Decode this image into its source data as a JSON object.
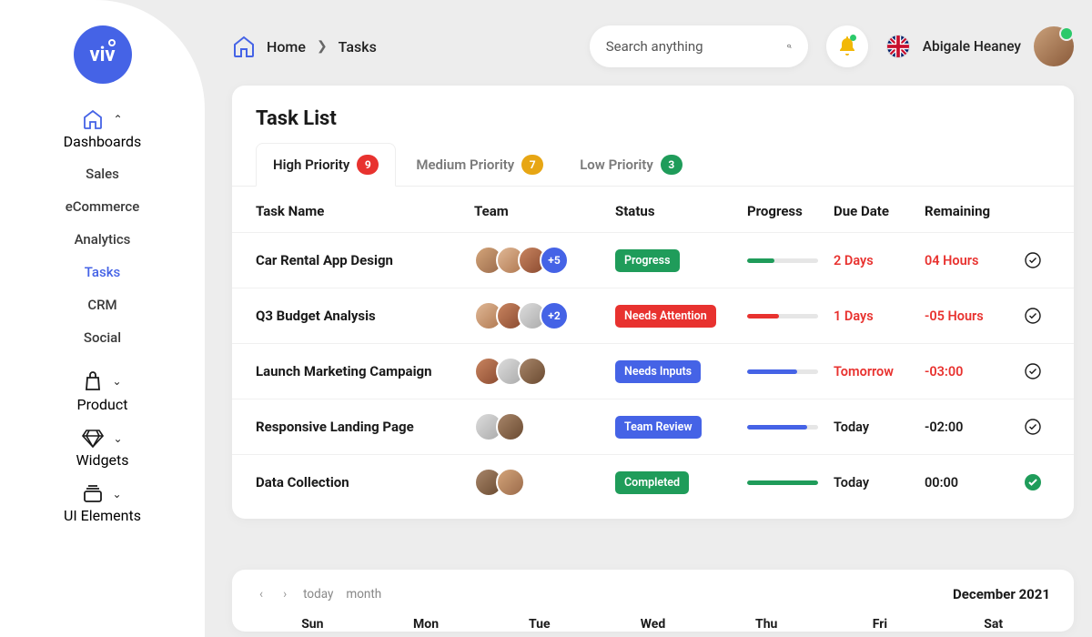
{
  "brand": "viv",
  "breadcrumb": {
    "home": "Home",
    "current": "Tasks"
  },
  "search": {
    "placeholder": "Search anything"
  },
  "user": {
    "name": "Abigale Heaney"
  },
  "sidebar": {
    "groups": [
      {
        "label": "Dashboards",
        "icon": "home",
        "expanded": true,
        "items": [
          "Sales",
          "eCommerce",
          "Analytics",
          "Tasks",
          "CRM",
          "Social"
        ],
        "activeIndex": 3
      },
      {
        "label": "Product",
        "icon": "bag",
        "expanded": false
      },
      {
        "label": "Widgets",
        "icon": "diamond",
        "expanded": false
      },
      {
        "label": "UI Elements",
        "icon": "stack",
        "expanded": false
      }
    ]
  },
  "card": {
    "title": "Task List",
    "tabs": [
      {
        "label": "High Priority",
        "count": "9",
        "color": "red",
        "active": true
      },
      {
        "label": "Medium Priority",
        "count": "7",
        "color": "yellow",
        "active": false
      },
      {
        "label": "Low Priority",
        "count": "3",
        "color": "green",
        "active": false
      }
    ],
    "columns": [
      "Task Name",
      "Team",
      "Status",
      "Progress",
      "Due Date",
      "Remaining"
    ],
    "rows": [
      {
        "name": "Car Rental App Design",
        "team": 3,
        "more": "+5",
        "status": "Progress",
        "statusColor": "green",
        "progress": 38,
        "progressColor": "green",
        "due": "2 Days",
        "dueColor": "red",
        "remain": "04 Hours",
        "remainColor": "red",
        "done": false
      },
      {
        "name": "Q3 Budget Analysis",
        "team": 3,
        "more": "+2",
        "status": "Needs Attention",
        "statusColor": "red",
        "progress": 45,
        "progressColor": "red",
        "due": "1 Days",
        "dueColor": "red",
        "remain": "-05 Hours",
        "remainColor": "red",
        "done": false
      },
      {
        "name": "Launch Marketing Campaign",
        "team": 3,
        "more": null,
        "status": "Needs Inputs",
        "statusColor": "blue",
        "progress": 70,
        "progressColor": "blue",
        "due": "Tomorrow",
        "dueColor": "red",
        "remain": "-03:00",
        "remainColor": "red",
        "done": false
      },
      {
        "name": "Responsive Landing Page",
        "team": 2,
        "more": null,
        "status": "Team Review",
        "statusColor": "blue",
        "progress": 85,
        "progressColor": "blue",
        "due": "Today",
        "dueColor": "dark",
        "remain": "-02:00",
        "remainColor": "dark",
        "done": false
      },
      {
        "name": "Data Collection",
        "team": 2,
        "more": null,
        "status": "Completed",
        "statusColor": "green",
        "progress": 100,
        "progressColor": "green",
        "due": "Today",
        "dueColor": "dark",
        "remain": "00:00",
        "remainColor": "dark",
        "done": true
      }
    ]
  },
  "calendar": {
    "today": "today",
    "month": "month",
    "title": "December 2021",
    "days": [
      "Sun",
      "Mon",
      "Tue",
      "Wed",
      "Thu",
      "Fri",
      "Sat"
    ]
  }
}
